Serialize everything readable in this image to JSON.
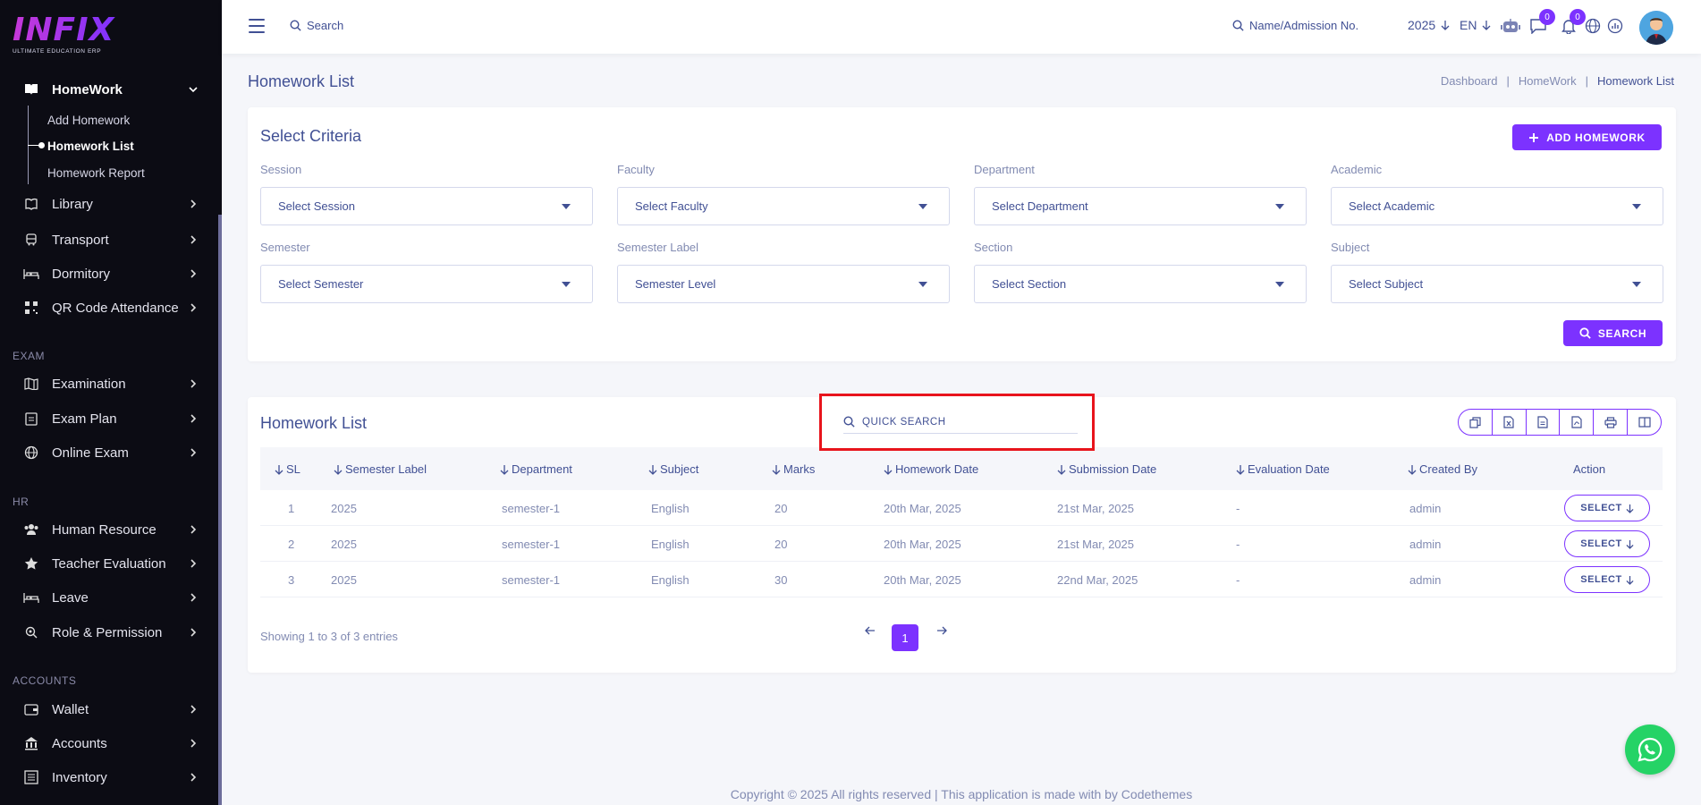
{
  "brand": {
    "logo_text": "INFIX",
    "logo_sub": "ULTIMATE EDUCATION ERP"
  },
  "sidebar": {
    "homework": {
      "label": "HomeWork",
      "sub": [
        "Add Homework",
        "Homework List",
        "Homework Report"
      ]
    },
    "items_top": [
      "Library",
      "Transport",
      "Dormitory",
      "QR Code Attendance"
    ],
    "section_exam": "EXAM",
    "items_exam": [
      "Examination",
      "Exam Plan",
      "Online Exam"
    ],
    "section_hr": "HR",
    "items_hr": [
      "Human Resource",
      "Teacher Evaluation",
      "Leave",
      "Role & Permission"
    ],
    "section_accounts": "ACCOUNTS",
    "items_accounts": [
      "Wallet",
      "Accounts",
      "Inventory"
    ]
  },
  "header": {
    "search_label": "Search",
    "admission_search": "Name/Admission No.",
    "year": "2025",
    "lang": "EN",
    "chat_badge": "0",
    "notif_badge": "0"
  },
  "page": {
    "title": "Homework List",
    "breadcrumb": [
      "Dashboard",
      "HomeWork",
      "Homework List"
    ]
  },
  "criteria": {
    "title": "Select Criteria",
    "add_button": "ADD HOMEWORK",
    "search_button": "SEARCH",
    "fields": [
      {
        "label": "Session",
        "placeholder": "Select Session"
      },
      {
        "label": "Faculty",
        "placeholder": "Select Faculty"
      },
      {
        "label": "Department",
        "placeholder": "Select Department"
      },
      {
        "label": "Academic",
        "placeholder": "Select Academic"
      },
      {
        "label": "Semester",
        "placeholder": "Select Semester"
      },
      {
        "label": "Semester Label",
        "placeholder": "Semester Level"
      },
      {
        "label": "Section",
        "placeholder": "Select Section"
      },
      {
        "label": "Subject",
        "placeholder": "Select Subject"
      }
    ]
  },
  "list": {
    "title": "Homework List",
    "quick_search": "QUICK SEARCH",
    "columns": [
      "SL",
      "Semester Label",
      "Department",
      "Subject",
      "Marks",
      "Homework Date",
      "Submission Date",
      "Evaluation Date",
      "Created By",
      "Action"
    ],
    "rows": [
      {
        "sl": "1",
        "semester_label": "2025",
        "department": "semester-1",
        "subject": "English",
        "marks": "20",
        "homework_date": "20th Mar, 2025",
        "submission_date": "21st Mar, 2025",
        "evaluation_date": "-",
        "created_by": "admin",
        "action": "SELECT"
      },
      {
        "sl": "2",
        "semester_label": "2025",
        "department": "semester-1",
        "subject": "English",
        "marks": "20",
        "homework_date": "20th Mar, 2025",
        "submission_date": "21st Mar, 2025",
        "evaluation_date": "-",
        "created_by": "admin",
        "action": "SELECT"
      },
      {
        "sl": "3",
        "semester_label": "2025",
        "department": "semester-1",
        "subject": "English",
        "marks": "30",
        "homework_date": "20th Mar, 2025",
        "submission_date": "22nd Mar, 2025",
        "evaluation_date": "-",
        "created_by": "admin",
        "action": "SELECT"
      }
    ],
    "showing": "Showing 1 to 3 of 3 entries",
    "current_page": "1"
  },
  "footer": "Copyright © 2025 All rights reserved | This application is made with by Codethemes"
}
